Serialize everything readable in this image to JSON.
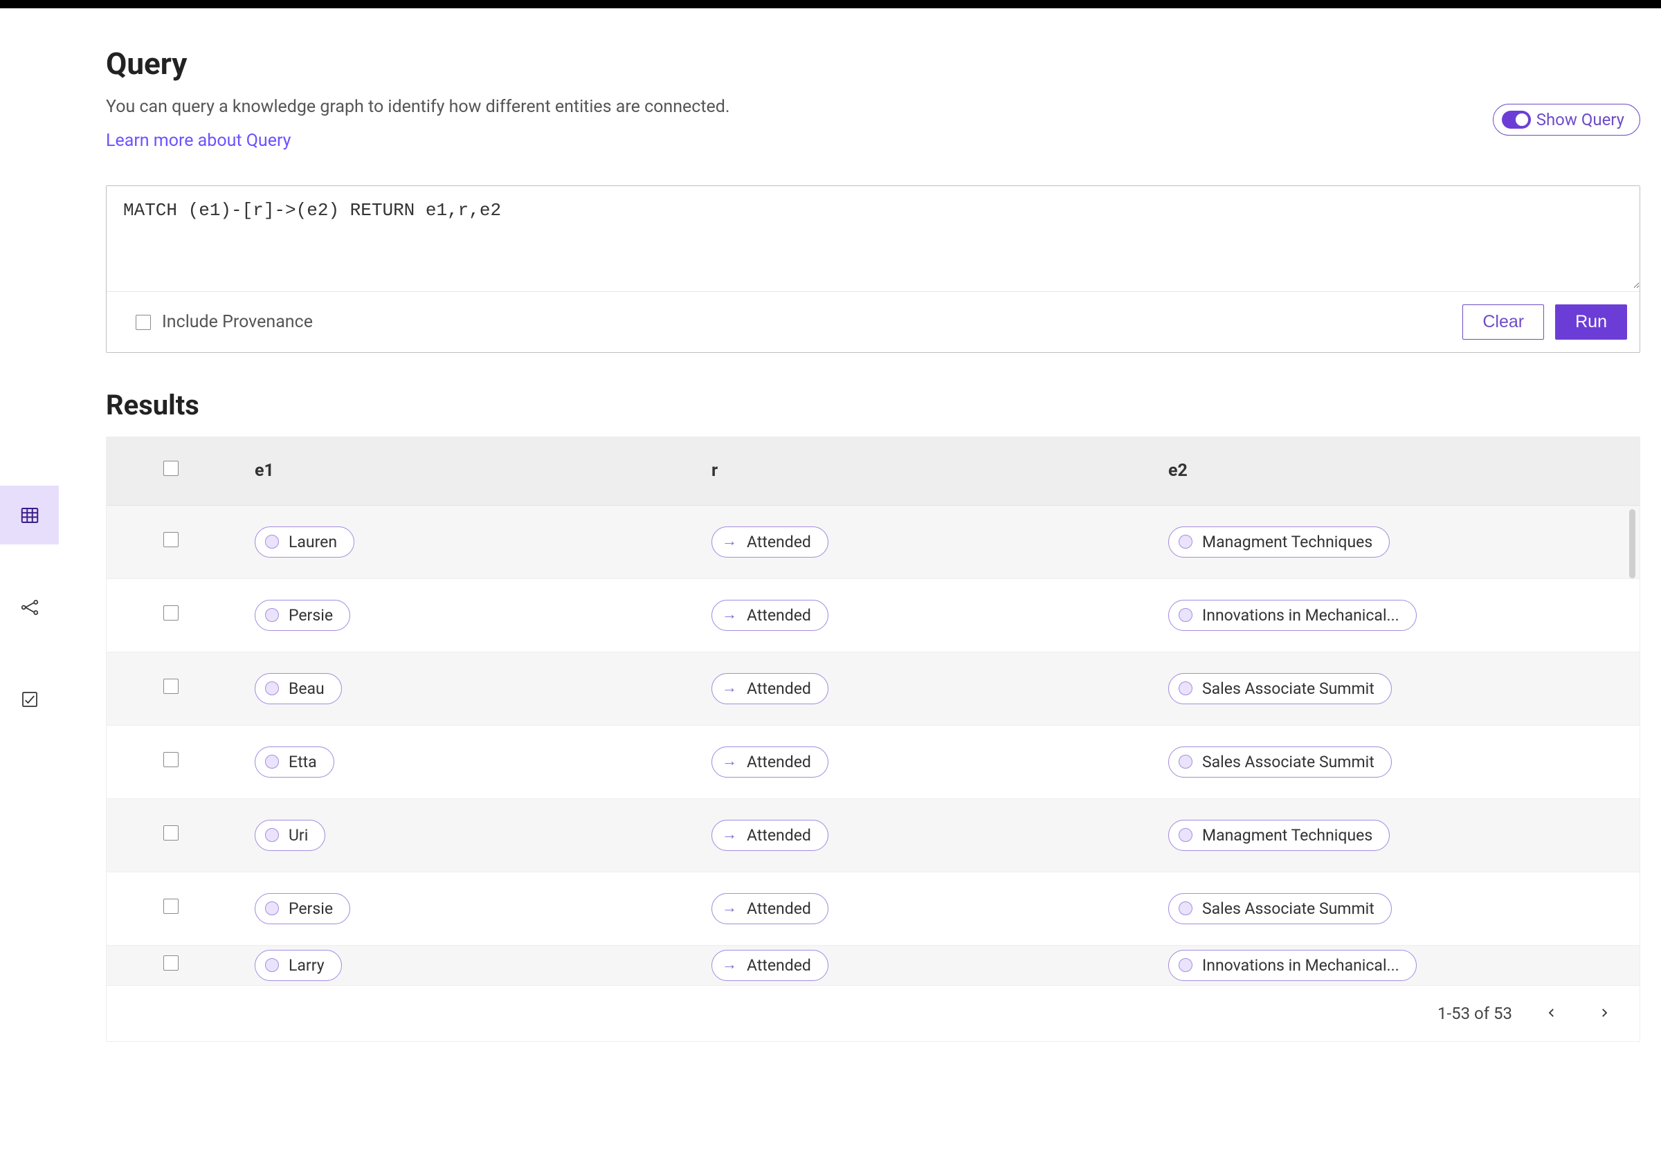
{
  "header": {
    "title": "Query",
    "subtitle": "You can query a knowledge graph to identify how different entities are connected.",
    "learn_link": "Learn more about Query",
    "toggle_label": "Show Query"
  },
  "query": {
    "text": "MATCH (e1)-[r]->(e2) RETURN e1,r,e2",
    "include_provenance_label": "Include Provenance",
    "clear_label": "Clear",
    "run_label": "Run"
  },
  "results": {
    "title": "Results",
    "columns": {
      "e1": "e1",
      "r": "r",
      "e2": "e2"
    },
    "rows": [
      {
        "e1": "Lauren",
        "r": "Attended",
        "e2": "Managment Techniques"
      },
      {
        "e1": "Persie",
        "r": "Attended",
        "e2": "Innovations in Mechanical..."
      },
      {
        "e1": "Beau",
        "r": "Attended",
        "e2": "Sales Associate Summit"
      },
      {
        "e1": "Etta",
        "r": "Attended",
        "e2": "Sales Associate Summit"
      },
      {
        "e1": "Uri",
        "r": "Attended",
        "e2": "Managment Techniques"
      },
      {
        "e1": "Persie",
        "r": "Attended",
        "e2": "Sales Associate Summit"
      },
      {
        "e1": "Larry",
        "r": "Attended",
        "e2": "Innovations in Mechanical..."
      }
    ],
    "pagination": "1-53 of 53"
  }
}
